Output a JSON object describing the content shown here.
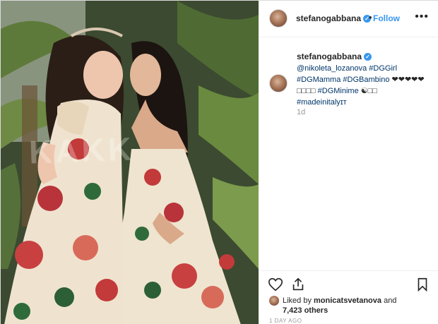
{
  "post": {
    "username": "stefanogabbana",
    "follow_label": "Follow",
    "separator": "•",
    "more_label": "•••",
    "verified_mark": "✓",
    "watermark": "KAKK"
  },
  "caption": {
    "username": "stefanogabbana",
    "mention": "@nikoleta_lozanova",
    "line1_tag": "#DGGirl",
    "line2_tag1": "#DGMamma",
    "line2_tag2": "#DGBambino",
    "line2_hearts": "❤❤❤❤❤",
    "line3_boxes": "□□□□",
    "line3_tag": "#DGMinime",
    "line3_symbol": "☯□□",
    "line4_tag": "#madeinitalyɪᴛ",
    "age": "1d"
  },
  "likes": {
    "prefix": "Liked by ",
    "user": "monicatsvetanova",
    "mid": " and",
    "count": "7,423 others"
  },
  "timestamp": "1 DAY AGO",
  "icons": {
    "heart": "heart-icon",
    "share": "share-icon",
    "bookmark": "bookmark-icon",
    "more": "more-options-icon",
    "verified": "verified-badge-icon"
  },
  "colors": {
    "link": "#3897f0",
    "hashtag": "#003569",
    "muted": "#999999"
  }
}
